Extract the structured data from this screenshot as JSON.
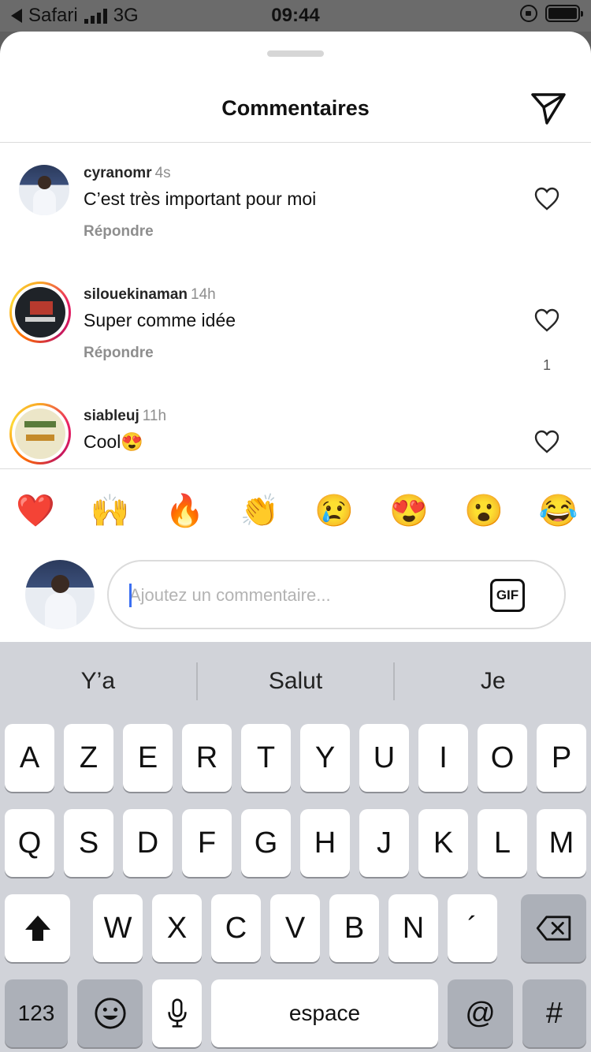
{
  "status_bar": {
    "back_app": "Safari",
    "network": "3G",
    "time": "09:44"
  },
  "sheet": {
    "title": "Commentaires",
    "send_icon": "paper-plane-icon"
  },
  "comments": [
    {
      "username": "cyranomr",
      "time": "4s",
      "text": "C’est très important pour moi",
      "reply_label": "Répondre",
      "likes": ""
    },
    {
      "username": "silouekinaman",
      "time": "14h",
      "text": "Super comme idée",
      "reply_label": "Répondre",
      "likes": "1"
    },
    {
      "username": "siableuj",
      "time": "11h",
      "text": "Cool😍",
      "reply_label": "",
      "likes": ""
    }
  ],
  "emoji_bar": [
    "❤️",
    "🙌",
    "🔥",
    "👏",
    "😢",
    "😍",
    "😮",
    "😂"
  ],
  "composer": {
    "placeholder": "Ajoutez un commentaire...",
    "gif_label": "GIF"
  },
  "keyboard": {
    "suggestions": [
      "Y’a",
      "Salut",
      "Je"
    ],
    "row1": [
      "A",
      "Z",
      "E",
      "R",
      "T",
      "Y",
      "U",
      "I",
      "O",
      "P"
    ],
    "row2": [
      "Q",
      "S",
      "D",
      "F",
      "G",
      "H",
      "J",
      "K",
      "L",
      "M"
    ],
    "row3": [
      "W",
      "X",
      "C",
      "V",
      "B",
      "N",
      "´"
    ],
    "numbers_label": "123",
    "space_label": "espace",
    "at_label": "@",
    "hash_label": "#"
  }
}
